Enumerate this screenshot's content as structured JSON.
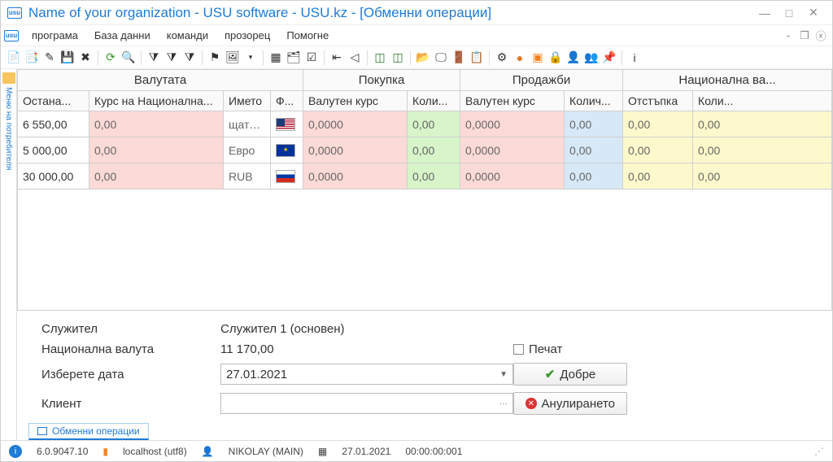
{
  "window": {
    "title": "Name of your organization - USU software - USU.kz - [Обменни операции]",
    "icon_text": "usu"
  },
  "menu": {
    "items": [
      "програма",
      "База данни",
      "команди",
      "прозорец",
      "Помогне"
    ]
  },
  "sidebar": {
    "label": "Меню на потребителя"
  },
  "grid": {
    "groups": [
      "Валутата",
      "Покупка",
      "Продажби",
      "Национална ва..."
    ],
    "columns": [
      "Остана...",
      "Курс на Национална...",
      "Името",
      "Ф...",
      "Валутен курс",
      "Коли...",
      "Валутен курс",
      "Колич...",
      "Отстъпка",
      "Коли..."
    ],
    "rows": [
      {
        "remain": "6 550,00",
        "nbrate": "0,00",
        "name": "щатски",
        "flag": "us",
        "buy_rate": "0,0000",
        "buy_qty": "0,00",
        "sell_rate": "0,0000",
        "sell_qty": "0,00",
        "disc": "0,00",
        "nqty": "0,00"
      },
      {
        "remain": "5 000,00",
        "nbrate": "0,00",
        "name": "Евро",
        "flag": "eu",
        "buy_rate": "0,0000",
        "buy_qty": "0,00",
        "sell_rate": "0,0000",
        "sell_qty": "0,00",
        "disc": "0,00",
        "nqty": "0,00"
      },
      {
        "remain": "30 000,00",
        "nbrate": "0,00",
        "name": "RUB",
        "flag": "ru",
        "buy_rate": "0,0000",
        "buy_qty": "0,00",
        "sell_rate": "0,0000",
        "sell_qty": "0,00",
        "disc": "0,00",
        "nqty": "0,00"
      }
    ]
  },
  "form": {
    "employee_label": "Служител",
    "employee_value": "Служител 1 (основен)",
    "natcur_label": "Национална валута",
    "natcur_value": "11 170,00",
    "date_label": "Изберете дата",
    "date_value": "27.01.2021",
    "client_label": "Клиент",
    "client_value": "",
    "print_label": "Печат",
    "ok_label": "Добре",
    "cancel_label": "Анулирането"
  },
  "bottom_tab": "Обменни операции",
  "status": {
    "version": "6.0.9047.10",
    "host": "localhost (utf8)",
    "user": "NIKOLAY (MAIN)",
    "date": "27.01.2021",
    "time": "00:00:00:001"
  }
}
